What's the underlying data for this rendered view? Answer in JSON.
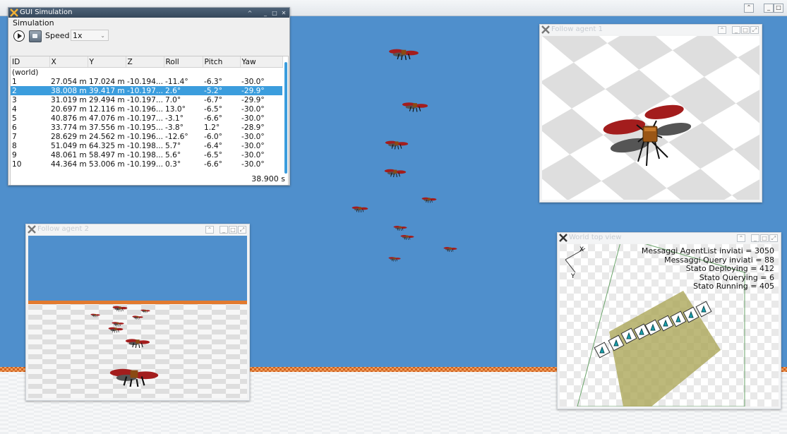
{
  "sim_window": {
    "title": "GUI Simulation",
    "menu": "Simulation",
    "speed_label": "Speed",
    "speed_value": "1x",
    "columns": [
      "ID",
      "X",
      "Y",
      "Z",
      "Roll",
      "Pitch",
      "Yaw"
    ],
    "rows": [
      [
        "(world)",
        "",
        "",
        "",
        "",
        "",
        ""
      ],
      [
        "1",
        "27.054 m",
        "17.024 m",
        "-10.194...",
        "-11.4°",
        "-6.3°",
        "-30.0°"
      ],
      [
        "2",
        "38.008 m",
        "39.417 m",
        "-10.197...",
        "2.6°",
        "-5.2°",
        "-29.9°"
      ],
      [
        "3",
        "31.019 m",
        "29.494 m",
        "-10.197...",
        "7.0°",
        "-6.7°",
        "-29.9°"
      ],
      [
        "4",
        "20.697 m",
        "12.116 m",
        "-10.196...",
        "13.0°",
        "-6.5°",
        "-30.0°"
      ],
      [
        "5",
        "40.876 m",
        "47.076 m",
        "-10.197...",
        "-3.1°",
        "-6.6°",
        "-30.0°"
      ],
      [
        "6",
        "33.774 m",
        "37.556 m",
        "-10.195...",
        "-3.8°",
        "1.2°",
        "-28.9°"
      ],
      [
        "7",
        "28.629 m",
        "24.562 m",
        "-10.196...",
        "-12.6°",
        "-6.0°",
        "-30.0°"
      ],
      [
        "8",
        "51.049 m",
        "64.325 m",
        "-10.198...",
        "5.7°",
        "-6.4°",
        "-30.0°"
      ],
      [
        "9",
        "48.061 m",
        "58.497 m",
        "-10.198...",
        "5.6°",
        "-6.5°",
        "-30.0°"
      ],
      [
        "10",
        "44.364 m",
        "53.006 m",
        "-10.199...",
        "0.3°",
        "-6.6°",
        "-30.0°"
      ]
    ],
    "selected_row_id": "2",
    "sim_time": "38.900 s"
  },
  "follow1": {
    "title": "Follow agent 1"
  },
  "follow2": {
    "title": "Follow agent 2"
  },
  "topview": {
    "title": "World top view",
    "stats": [
      "Messaggi AgentList inviati = 3050",
      "Messaggi Query inviati = 88",
      "Stato Deploying = 412",
      "Stato Querying = 6",
      "Stato Running = 405"
    ]
  },
  "colors": {
    "sky": "#4f8fcc",
    "horizon": "#e27a2f",
    "selection": "#3b9ddd",
    "rotor_red": "#a31d1d",
    "rotor_grey": "#555555",
    "zone_fill": "#a7a24f"
  }
}
